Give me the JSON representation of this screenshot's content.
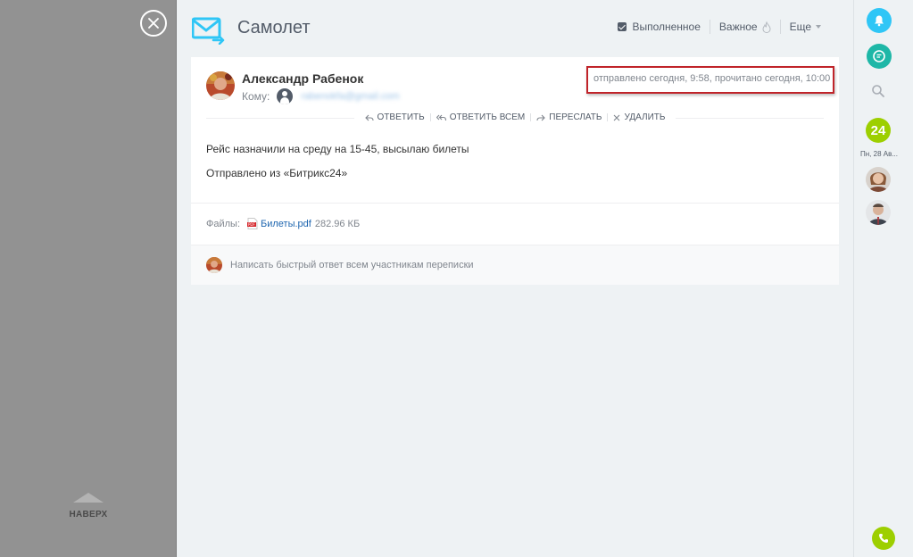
{
  "overlay": {
    "to_top_label": "НАВЕРХ"
  },
  "header": {
    "title": "Самолет",
    "done_label": "Выполненное",
    "done_checked": true,
    "important_label": "Важное",
    "more_label": "Еще"
  },
  "message": {
    "sender_name": "Александр Рабенок",
    "to_label": "Кому:",
    "to_email": "rabenokfa@gmail.com",
    "sent_info": "отправлено сегодня, 9:58, прочитано сегодня, 10:00",
    "actions": {
      "reply": "Ответить",
      "reply_all": "Ответить всем",
      "forward": "Переслать",
      "delete": "Удалить"
    },
    "body": [
      "Рейс назначили на среду на 15-45, высылаю билеты",
      "Отправлено из «Битрикс24»"
    ],
    "files_label": "Файлы:",
    "file_name": "Билеты.pdf",
    "file_size": "282.96 КБ",
    "reply_placeholder": "Написать быстрый ответ всем участникам переписки"
  },
  "rightbar": {
    "counter": "24",
    "date_label": "Пн, 28 Ав..."
  },
  "colors": {
    "accent_blue": "#2fc6f6",
    "accent_teal": "#1eb7a7",
    "accent_green": "#9dcf00",
    "highlight_red": "#c0242a",
    "link": "#2067b0"
  }
}
